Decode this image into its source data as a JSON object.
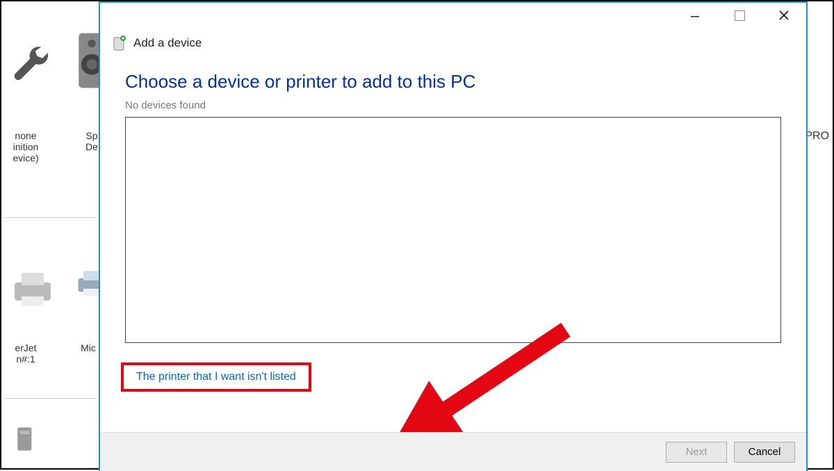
{
  "background": {
    "item_a_lines": [
      "none",
      "inition",
      "evice)"
    ],
    "item_b_lines": [
      "Sp",
      "De"
    ],
    "item_c_lines": [
      "erJet",
      "n#:1"
    ],
    "item_d_lines": [
      "Mic"
    ],
    "right_label": "PRO"
  },
  "wizard": {
    "caption": "Add a device",
    "heading": "Choose a device or printer to add to this PC",
    "status": "No devices found",
    "not_listed_link": "The printer that I want isn't listed"
  },
  "footer": {
    "next": "Next",
    "cancel": "Cancel"
  }
}
